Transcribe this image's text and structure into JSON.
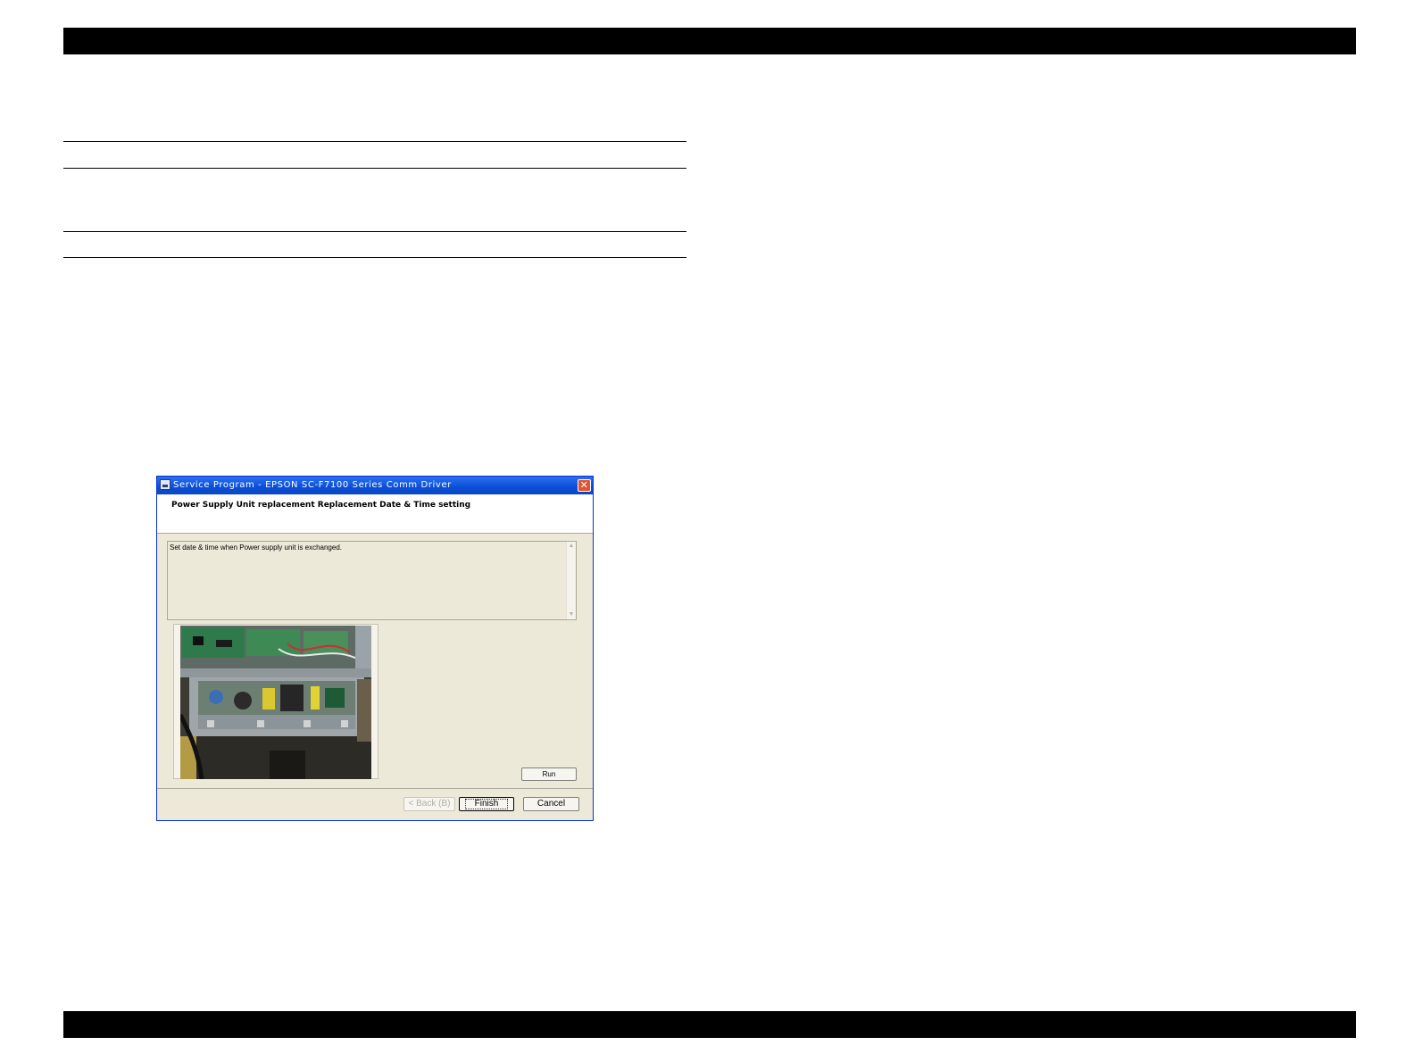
{
  "dialog": {
    "title": "Service Program - EPSON SC-F7100 Series Comm Driver",
    "header": "Power Supply Unit replacement Replacement  Date & Time setting",
    "description": "Set date & time when Power supply unit is exchanged.",
    "image_description": "",
    "buttons": {
      "run": "Run",
      "back": "< Back (B)",
      "finish": "Finish",
      "cancel": "Cancel"
    }
  },
  "colors": {
    "titlebar": "#0a4fd8",
    "dialog_bg": "#ece9d8",
    "page_bars": "#000000"
  }
}
